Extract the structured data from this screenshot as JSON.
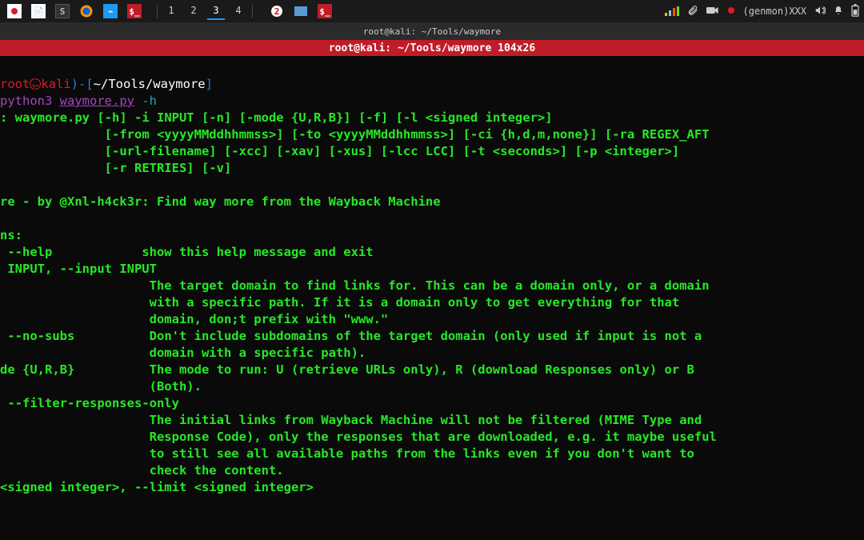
{
  "taskbar": {
    "workspaces": [
      "1",
      "2",
      "3",
      "4"
    ],
    "active_ws_index": 2,
    "right": {
      "genmon": "(genmon)XXX"
    }
  },
  "window": {
    "title": "root@kali: ~/Tools/waymore",
    "dimensions": "root@kali: ~/Tools/waymore 104x26"
  },
  "prompt": {
    "user": "root",
    "host": "kali",
    "path": "~/Tools/waymore",
    "command_interp": "python3",
    "command_script": "waymore.py",
    "command_flag": "-h"
  },
  "usage": {
    "prefix": ": waymore.py ",
    "l1": "[-h] -i INPUT [-n] [-mode {U,R,B}] [-f] [-l <signed integer>]",
    "l2": "[-from <yyyyMMddhhmmss>] [-to <yyyyMMddhhmmss>] [-ci {h,d,m,none}] [-ra REGEX_AFT",
    "l3": "[-url-filename] [-xcc] [-xav] [-xus] [-lcc LCC] [-t <seconds>] [-p <integer>]",
    "l4": "[-r RETRIES] [-v]"
  },
  "tagline": "re - by @Xnl-h4ck3r: Find way more from the Wayback Machine",
  "options_header": "ns:",
  "options": {
    "help_flag": " --help",
    "help_desc": "show this help message and exit",
    "input_flag": " INPUT, --input INPUT",
    "input_desc1": "The target domain to find links for. This can be a domain only, or a domain",
    "input_desc2": "with a specific path. If it is a domain only to get everything for that",
    "input_desc3": "domain, don;t prefix with \"www.\"",
    "nosubs_flag": " --no-subs",
    "nosubs_desc1": "Don't include subdomains of the target domain (only used if input is not a",
    "nosubs_desc2": "domain with a specific path).",
    "mode_flag": "de {U,R,B}",
    "mode_desc1": "The mode to run: U (retrieve URLs only), R (download Responses only) or B",
    "mode_desc2": "(Both).",
    "filter_flag": " --filter-responses-only",
    "filter_desc1": "The initial links from Wayback Machine will not be filtered (MIME Type and",
    "filter_desc2": "Response Code), only the responses that are downloaded, e.g. it maybe useful",
    "filter_desc3": "to still see all available paths from the links even if you don't want to",
    "filter_desc4": "check the content.",
    "limit_flag": "<signed integer>, --limit <signed integer>"
  }
}
